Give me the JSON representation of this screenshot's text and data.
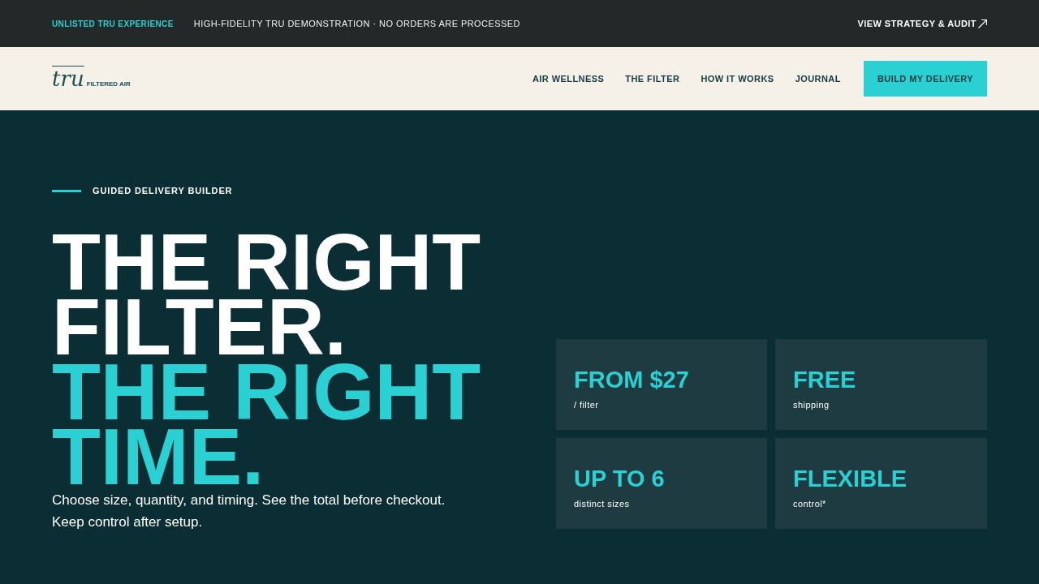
{
  "top_bar": {
    "badge": "UNLISTED TRU EXPERIENCE",
    "notice": "HIGH-FIDELITY TRU DEMONSTRATION · NO ORDERS ARE PROCESSED",
    "link": "VIEW STRATEGY & AUDIT"
  },
  "nav": {
    "logo": {
      "wordmark": "tru",
      "tagline": "FILTERED AIR"
    },
    "links": [
      "AIR WELLNESS",
      "THE FILTER",
      "HOW IT WORKS",
      "JOURNAL"
    ],
    "cta": "BUILD MY DELIVERY"
  },
  "hero": {
    "eyebrow": "GUIDED DELIVERY BUILDER",
    "headline": "THE RIGHT FILTER.",
    "headline_accent": "THE RIGHT TIME.",
    "description": "Choose size, quantity, and timing. See the total before checkout. Keep control after setup.",
    "stats": [
      {
        "value": "FROM $27",
        "label": "/ filter"
      },
      {
        "value": "FREE",
        "label": "shipping"
      },
      {
        "value": "UP TO 6",
        "label": "distinct sizes"
      },
      {
        "value": "FLEXIBLE",
        "label": "control*"
      }
    ]
  }
}
